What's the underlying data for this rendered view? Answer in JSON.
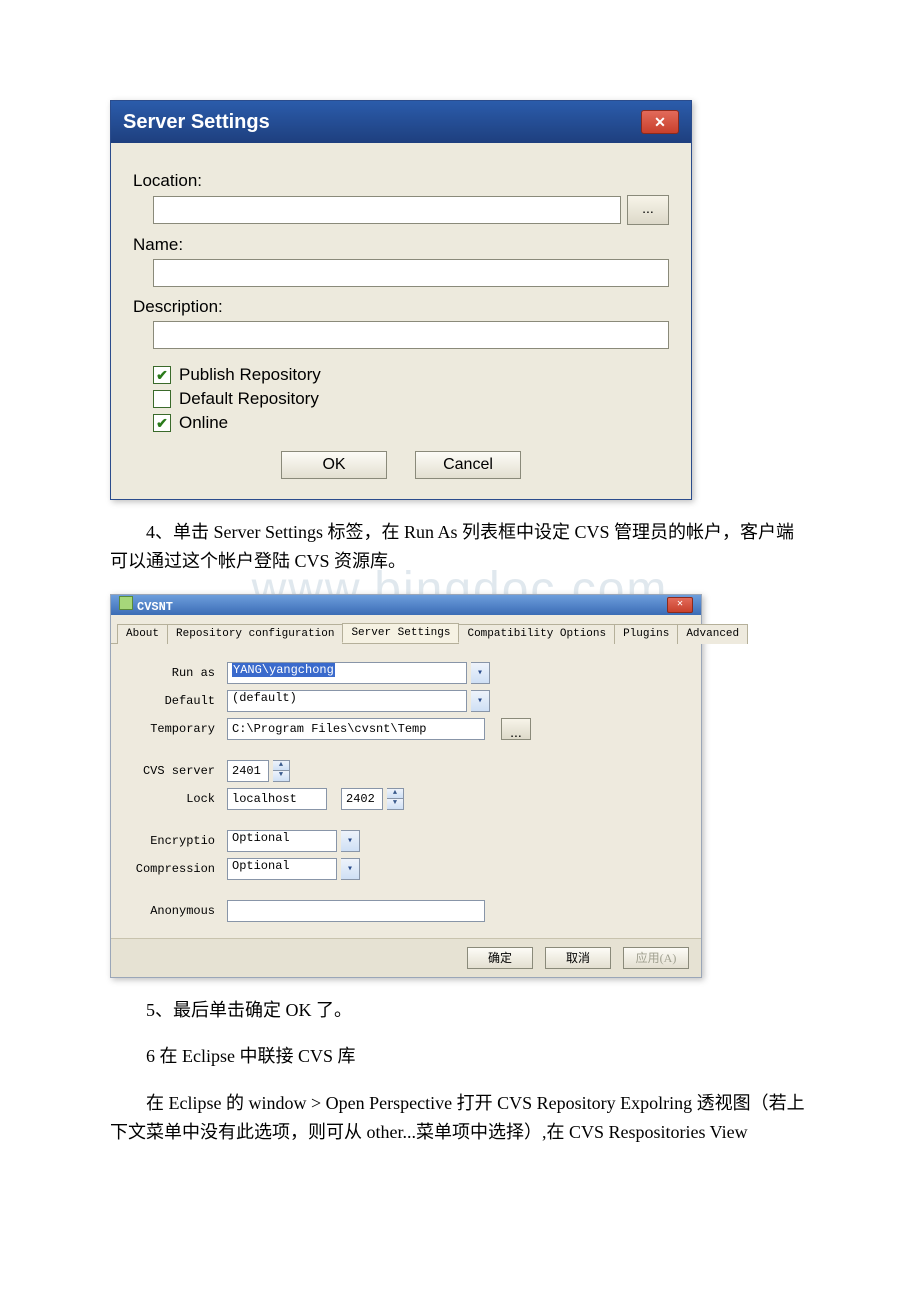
{
  "dialog1": {
    "title": "Server Settings",
    "location_label": "Location:",
    "location_value": "",
    "browse_label": "...",
    "name_label": "Name:",
    "name_value": "",
    "description_label": "Description:",
    "description_value": "",
    "publish_label": "Publish Repository",
    "publish_checked": true,
    "default_label": "Default Repository",
    "default_checked": false,
    "online_label": "Online",
    "online_checked": true,
    "ok_label": "OK",
    "cancel_label": "Cancel"
  },
  "para1": "4、单击 Server Settings 标签，在 Run As 列表框中设定 CVS 管理员的帐户，客户端可以通过这个帐户登陆 CVS 资源库。",
  "watermark": "www.bingdoc.com",
  "dialog2": {
    "title": "CVSNT",
    "tabs": [
      "About",
      "Repository configuration",
      "Server Settings",
      "Compatibility Options",
      "Plugins",
      "Advanced"
    ],
    "active_tab": 2,
    "fields": {
      "runas_label": "Run as",
      "runas_value": "YANG\\yangchong",
      "default_label": "Default",
      "default_value": "(default)",
      "temp_label": "Temporary",
      "temp_value": "C:\\Program Files\\cvsnt\\Temp",
      "temp_browse": "...",
      "cvsserver_label": "CVS server",
      "cvsserver_value": "2401",
      "lock_label": "Lock",
      "lock_host": "localhost",
      "lock_port": "2402",
      "encryption_label": "Encryptio",
      "encryption_value": "Optional",
      "compression_label": "Compression",
      "compression_value": "Optional",
      "anonymous_label": "Anonymous",
      "anonymous_value": ""
    },
    "buttons": {
      "ok": "确定",
      "cancel": "取消",
      "apply": "应用(A)"
    }
  },
  "para2": "5、最后单击确定 OK 了。",
  "para3": "6 在 Eclipse 中联接 CVS 库",
  "para4": "在 Eclipse 的 window > Open Perspective 打开 CVS Repository Expolring 透视图（若上下文菜单中没有此选项，则可从 other...菜单项中选择）,在 CVS Respositories View"
}
